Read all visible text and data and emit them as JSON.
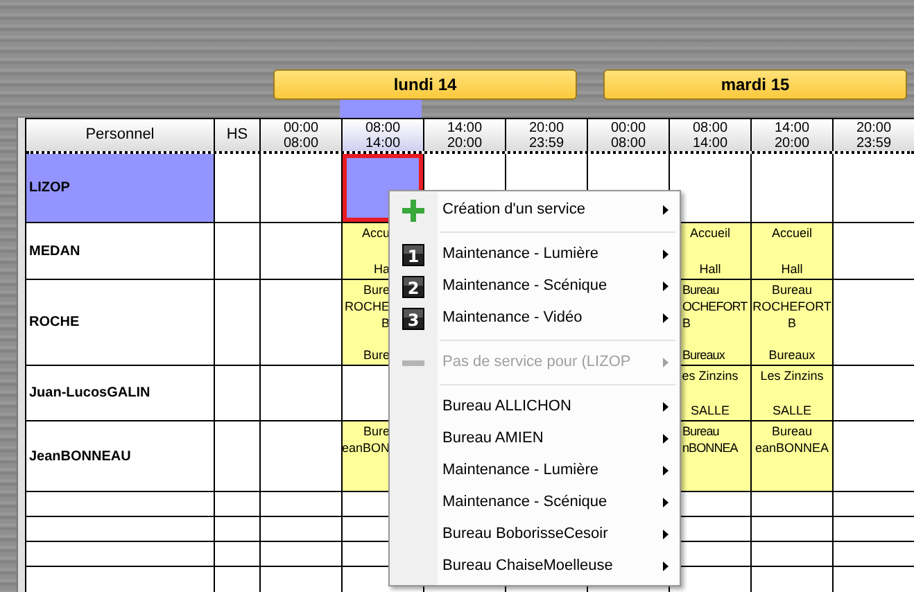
{
  "days": [
    {
      "label": "lundi 14"
    },
    {
      "label": "mardi 15"
    }
  ],
  "columns": [
    {
      "label": "Personnel"
    },
    {
      "label": "HS"
    },
    {
      "from": "00:00",
      "to": "08:00",
      "selected": false
    },
    {
      "from": "08:00",
      "to": "14:00",
      "selected": true
    },
    {
      "from": "14:00",
      "to": "20:00",
      "selected": false
    },
    {
      "from": "20:00",
      "to": "23:59",
      "selected": false
    },
    {
      "from": "00:00",
      "to": "08:00",
      "selected": false
    },
    {
      "from": "08:00",
      "to": "14:00",
      "selected": false
    },
    {
      "from": "14:00",
      "to": "20:00",
      "selected": false
    },
    {
      "from": "20:00",
      "to": "23:59",
      "selected": false
    }
  ],
  "rows": [
    {
      "name": "LIZOP",
      "selected": true,
      "cells": [
        null,
        {
          "selected": true
        },
        null,
        null,
        null,
        null,
        null,
        null
      ]
    },
    {
      "name": "MEDAN",
      "selected": false,
      "cells": [
        null,
        {
          "selected": false,
          "kind": "covered",
          "lines": [
            "Accu"
          ],
          "footer": "Ha"
        },
        null,
        null,
        null,
        {
          "selected": false,
          "lines": [
            "Accueil"
          ],
          "footer": "Hall"
        },
        {
          "selected": false,
          "lines": [
            "Accueil"
          ],
          "footer": "Hall"
        },
        null
      ]
    },
    {
      "name": "ROCHE",
      "selected": false,
      "cells": [
        null,
        {
          "selected": false,
          "kind": "covered",
          "lines": [
            "Bure",
            "ROCHE",
            "B"
          ],
          "footer": "Bure"
        },
        null,
        null,
        null,
        {
          "selected": false,
          "kind": "trimmed",
          "lines": [
            "Bureau",
            "OCHEFORT",
            "B"
          ],
          "footer": "Bureaux"
        },
        {
          "selected": false,
          "lines": [
            "Bureau",
            "ROCHEFORT",
            "B"
          ],
          "footer": "Bureaux"
        },
        null
      ]
    },
    {
      "name": "Juan-LucosGALIN",
      "selected": false,
      "cells": [
        null,
        null,
        null,
        null,
        null,
        {
          "selected": false,
          "lines": [
            "es Zinzins"
          ],
          "footer": "SALLE"
        },
        {
          "selected": false,
          "lines": [
            "Les Zinzins"
          ],
          "footer": "SALLE"
        },
        null
      ]
    },
    {
      "name": "JeanBONNEAU",
      "selected": false,
      "cells": [
        null,
        {
          "selected": false,
          "kind": "covered",
          "lines": [
            "Bure",
            "eanBON"
          ]
        },
        null,
        null,
        null,
        {
          "selected": false,
          "kind": "trimmed",
          "lines": [
            "Bureau",
            "nBONNEA"
          ]
        },
        {
          "selected": false,
          "lines": [
            "Bureau",
            "eanBONNEA"
          ]
        },
        null
      ]
    }
  ],
  "menu": [
    {
      "kind": "create",
      "label": "Création d'un service",
      "disabled": false
    },
    {
      "kind": "separator"
    },
    {
      "kind": "numbered",
      "number": "1",
      "label": "Maintenance - Lumière",
      "disabled": false
    },
    {
      "kind": "numbered",
      "number": "2",
      "label": "Maintenance - Scénique",
      "disabled": false
    },
    {
      "kind": "numbered",
      "number": "3",
      "label": "Maintenance - Vidéo",
      "disabled": false
    },
    {
      "kind": "separator"
    },
    {
      "kind": "none",
      "label": "Pas de service pour (LIZOP",
      "disabled": true
    },
    {
      "kind": "separator"
    },
    {
      "kind": "item",
      "label": "Bureau ALLICHON",
      "disabled": false
    },
    {
      "kind": "item",
      "label": "Bureau AMIEN",
      "disabled": false
    },
    {
      "kind": "item",
      "label": "Maintenance - Lumière",
      "disabled": false
    },
    {
      "kind": "item",
      "label": "Maintenance - Scénique",
      "disabled": false
    },
    {
      "kind": "item",
      "label": "Bureau BoborisseCesoir",
      "disabled": false
    },
    {
      "kind": "item",
      "label": "Bureau ChaiseMoelleuse",
      "disabled": false
    }
  ]
}
